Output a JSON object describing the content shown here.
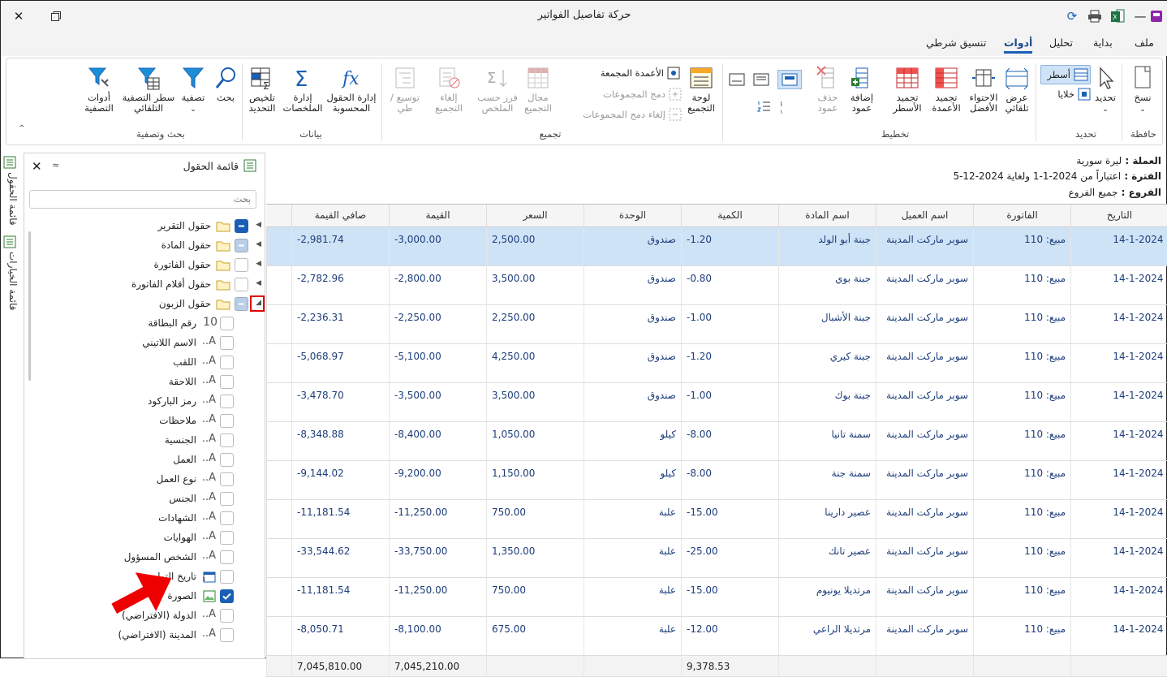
{
  "window": {
    "title": "حركة تفاصيل الفواتير"
  },
  "menu": {
    "tabs": [
      "ملف",
      "بداية",
      "تحليل",
      "أدوات",
      "تنسيق شرطي"
    ],
    "active": "أدوات"
  },
  "ribbon": {
    "clipboard": {
      "group": "حافظة",
      "copy": "نسخ"
    },
    "select": {
      "group": "تحديد",
      "select": "تحديد",
      "rows": "أسطر",
      "cells": "خلايا"
    },
    "layout": {
      "group": "تخطيط",
      "auto_view": "عرض تلقائي",
      "best_fit": "الاحتواء الأفضل",
      "freeze_cols": "تجميد الأعمدة",
      "freeze_rows": "تجميد الأسطر",
      "add_col": "إضافة عمود",
      "del_col": "حذف عمود"
    },
    "grouping": {
      "group": "تجميع",
      "panel": "لوحة التجميع",
      "grouped_cols": "الأعمدة المجمعة",
      "merge_groups": "دمج المجموعات",
      "unmerge_groups": "إلغاء دمج المجموعات",
      "group_range": "مجال التجميع",
      "sort_summary": "فرز حسب الملخص",
      "cancel_group": "إلغاء التجميع",
      "expand": "توسيع / طي"
    },
    "data": {
      "group": "بيانات",
      "calc_fields": "إدارة الحقول المحسوبة",
      "summaries": "إدارة الملخصات",
      "sel_summary": "تلخيص التحديد"
    },
    "search": {
      "group": "بحث وتصفية",
      "search": "بحث",
      "filter": "تصفية",
      "auto_filter": "سطر التصفية التلقائي",
      "filter_tools": "أدوات التصفية"
    }
  },
  "info": {
    "currency_label": "العملة",
    "currency": "ليرة سورية",
    "period_label": "الفترة",
    "period": "اعتباراً من 2024-1-1 ولغاية 2024-12-5",
    "branches_label": "الفروع",
    "branches": "جميع الفروع"
  },
  "grid": {
    "headers": [
      "التاريخ",
      "الفاتورة",
      "اسم العميل",
      "اسم المادة",
      "الكمية",
      "الوحدة",
      "السعر",
      "القيمة",
      "صافي القيمة"
    ],
    "rows": [
      [
        "14-1-2024",
        "مبيع: 110",
        "سوبر ماركت المدينة",
        "جبنة أبو الولد",
        "-1.20",
        "صندوق",
        "2,500.00",
        "-3,000.00",
        "-2,981.74"
      ],
      [
        "14-1-2024",
        "مبيع: 110",
        "سوبر ماركت المدينة",
        "جبنة بوي",
        "-0.80",
        "صندوق",
        "3,500.00",
        "-2,800.00",
        "-2,782.96"
      ],
      [
        "14-1-2024",
        "مبيع: 110",
        "سوبر ماركت المدينة",
        "جبنة الأشبال",
        "-1.00",
        "صندوق",
        "2,250.00",
        "-2,250.00",
        "-2,236.31"
      ],
      [
        "14-1-2024",
        "مبيع: 110",
        "سوبر ماركت المدينة",
        "جبنة كيري",
        "-1.20",
        "صندوق",
        "4,250.00",
        "-5,100.00",
        "-5,068.97"
      ],
      [
        "14-1-2024",
        "مبيع: 110",
        "سوبر ماركت المدينة",
        "جبنة بوك",
        "-1.00",
        "صندوق",
        "3,500.00",
        "-3,500.00",
        "-3,478.70"
      ],
      [
        "14-1-2024",
        "مبيع: 110",
        "سوبر ماركت المدينة",
        "سمنة تانيا",
        "-8.00",
        "كيلو",
        "1,050.00",
        "-8,400.00",
        "-8,348.88"
      ],
      [
        "14-1-2024",
        "مبيع: 110",
        "سوبر ماركت المدينة",
        "سمنة جنة",
        "-8.00",
        "كيلو",
        "1,150.00",
        "-9,200.00",
        "-9,144.02"
      ],
      [
        "14-1-2024",
        "مبيع: 110",
        "سوبر ماركت المدينة",
        "عصير دارينا",
        "-15.00",
        "علبة",
        "750.00",
        "-11,250.00",
        "-11,181.54"
      ],
      [
        "14-1-2024",
        "مبيع: 110",
        "سوبر ماركت المدينة",
        "عصير تانك",
        "-25.00",
        "علبة",
        "1,350.00",
        "-33,750.00",
        "-33,544.62"
      ],
      [
        "14-1-2024",
        "مبيع: 110",
        "سوبر ماركت المدينة",
        "مرتديلا يونيوم",
        "-15.00",
        "علبة",
        "750.00",
        "-11,250.00",
        "-11,181.54"
      ],
      [
        "14-1-2024",
        "مبيع: 110",
        "سوبر ماركت المدينة",
        "مرتديلا الراعي",
        "-12.00",
        "علبة",
        "675.00",
        "-8,100.00",
        "-8,050.71"
      ]
    ],
    "totals": {
      "qty": "9,378.53",
      "value": "7,045,210.00",
      "net": "7,045,810.00"
    }
  },
  "field_panel": {
    "title": "قائمة الحقول",
    "search_placeholder": "بحث",
    "groups": [
      "حقول التقرير",
      "حقول المادة",
      "حقول الفاتورة",
      "حقول أقلام الفاتورة",
      "حقول الزبون"
    ],
    "fields": [
      "رقم البطاقة",
      "الاسم اللاتيني",
      "اللقب",
      "اللاحقة",
      "رمز الباركود",
      "ملاحظات",
      "الجنسية",
      "العمل",
      "نوع العمل",
      "الجنس",
      "الشهادات",
      "الهوايات",
      "الشخص المسؤول",
      "تاريخ التولد",
      "الصورة",
      "الدولة (الافتراضي)",
      "المدينة (الافتراضي)"
    ]
  },
  "side_tabs": {
    "fields": "قائمة الحقول",
    "options": "قائمة الخيارات"
  }
}
